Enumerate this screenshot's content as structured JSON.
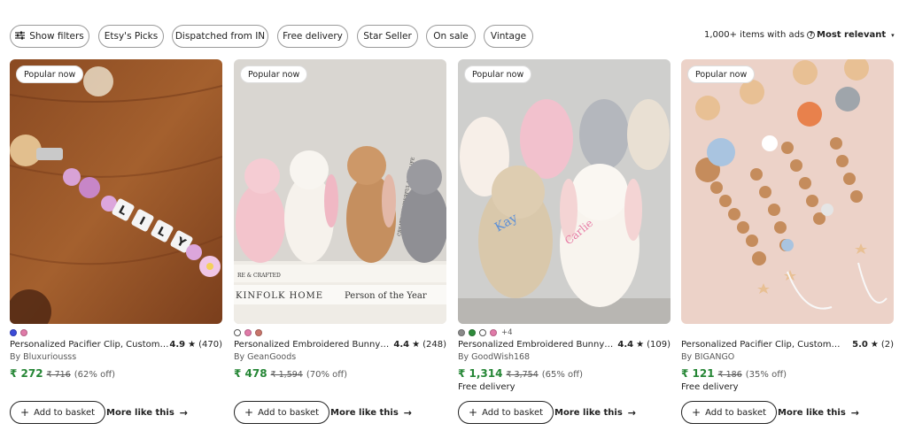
{
  "filters": {
    "show_filters": "Show filters",
    "chips": [
      "Etsy's Picks",
      "Dispatched from IN",
      "Free delivery",
      "Star Seller",
      "On sale",
      "Vintage"
    ],
    "results_text": "1,000+ items with ads",
    "info_icon": "?",
    "sort_label": "Most relevant",
    "sort_caret": "▾"
  },
  "products": [
    {
      "badge": "Popular now",
      "title": "Personalized Pacifier Clip, Custom",
      "rating": "4.9",
      "reviews": "(470)",
      "shop": "By Bluxuriousss",
      "price": "₹ 272",
      "original_price": "₹ 716",
      "discount": "(62% off)",
      "delivery": "",
      "swatches": [
        "#3b4bd8",
        "#e07aa8"
      ],
      "more_swatches": ""
    },
    {
      "badge": "Popular now",
      "title": "Personalized Embroidered Bunny",
      "rating": "4.4",
      "reviews": "(248)",
      "shop": "By GeanGoods",
      "price": "₹ 478",
      "original_price": "₹ 1,594",
      "discount": "(70% off)",
      "delivery": "",
      "swatches": [
        "#ffffff",
        "#e07aa8",
        "#c9756b"
      ],
      "more_swatches": ""
    },
    {
      "badge": "Popular now",
      "title": "Personalized Embroidered Bunny",
      "rating": "4.4",
      "reviews": "(109)",
      "shop": "By GoodWish168",
      "price": "₹ 1,314",
      "original_price": "₹ 3,754",
      "discount": "(65% off)",
      "delivery": "Free delivery",
      "swatches": [
        "#8a8a8a",
        "#2e8b3a",
        "#ffffff",
        "#e07aa8"
      ],
      "more_swatches": "+4"
    },
    {
      "badge": "Popular now",
      "title": "Personalized Pacifier Clip, Custom",
      "rating": "5.0",
      "reviews": "(2)",
      "shop": "By BIGANGO",
      "price": "₹ 121",
      "original_price": "₹ 186",
      "discount": "(35% off)",
      "delivery": "Free delivery",
      "swatches": [],
      "more_swatches": ""
    }
  ],
  "card_actions": {
    "add_to_basket": "Add to basket",
    "more_like_this": "More like this",
    "plus_glyph": "+",
    "arrow_glyph": "→",
    "star_glyph": "★"
  },
  "image_text": {
    "bead_letters": [
      "L",
      "I",
      "L",
      "Y"
    ],
    "book_spines": [
      "RE & CRAFTED",
      "KINFOLK HOME",
      "Person of the Year",
      "CREATE WONDERFUL HOMELIFE"
    ]
  },
  "colors": {
    "price_green": "#258635",
    "chip_border": "#9a9a9a"
  }
}
